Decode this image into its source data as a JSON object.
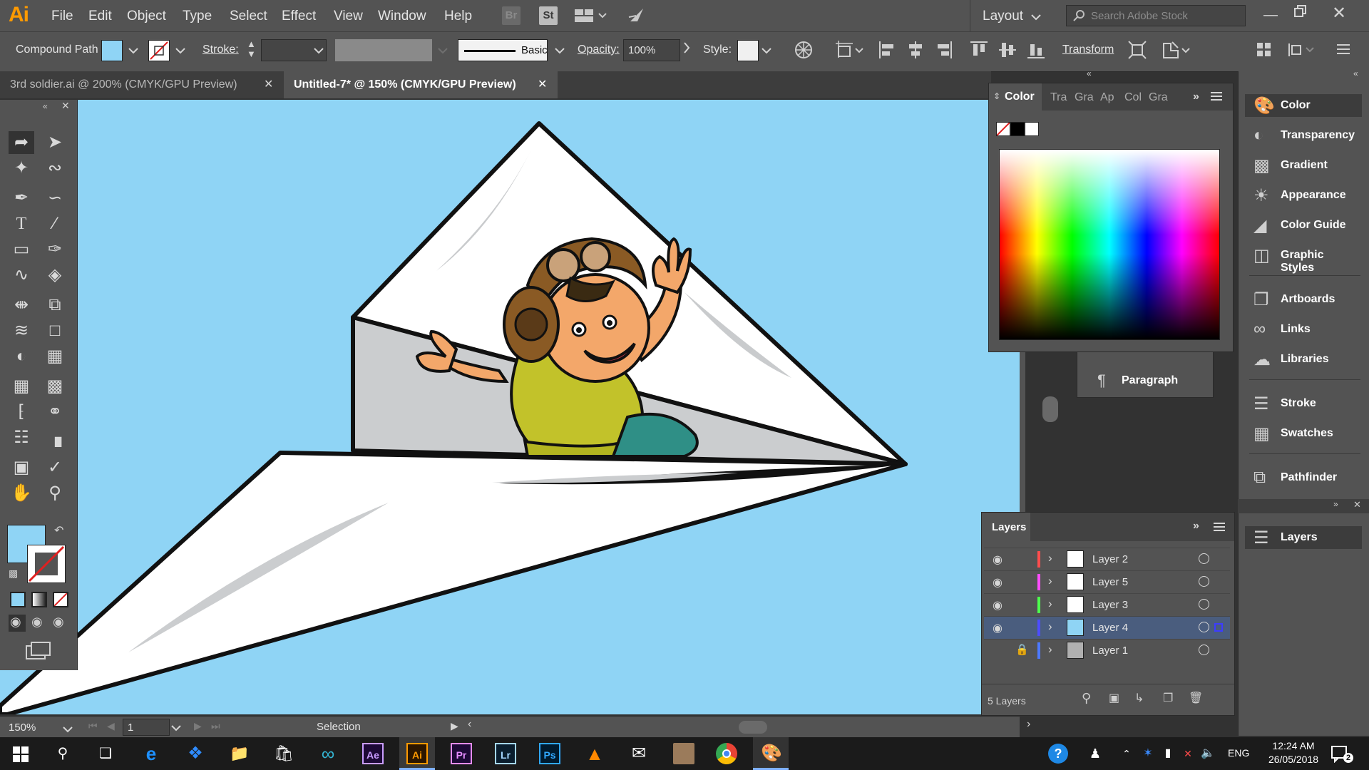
{
  "app": {
    "logo": "Ai",
    "accent": "#ff9a00"
  },
  "menu": [
    "File",
    "Edit",
    "Object",
    "Type",
    "Select",
    "Effect",
    "View",
    "Window",
    "Help"
  ],
  "menu_icons": {
    "bridge": "Br",
    "stock": "St"
  },
  "workspace": {
    "label": "Layout"
  },
  "search": {
    "placeholder": "Search Adobe Stock"
  },
  "control": {
    "selection_type": "Compound Path",
    "stroke_label": "Stroke:",
    "brush_label": "Basic",
    "opacity_label": "Opacity:",
    "opacity_value": "100%",
    "style_label": "Style:",
    "transform_label": "Transform"
  },
  "tabs": [
    {
      "label": "3rd soldier.ai @ 200% (CMYK/GPU Preview)",
      "active": false
    },
    {
      "label": "Untitled-7* @ 150% (CMYK/GPU Preview)",
      "active": true
    }
  ],
  "colors": {
    "fill": "#8fd4f5",
    "canvas": "#8fd4f5",
    "highlight": "#4a5d7e"
  },
  "color_panel": {
    "tabs": [
      "Color",
      "Tra",
      "Gra",
      "Ap",
      "Col",
      "Gra"
    ]
  },
  "partial_panel": {
    "paragraph": "Paragraph"
  },
  "dock": [
    {
      "label": "Color",
      "icon": "palette-icon"
    },
    {
      "label": "Transparency",
      "icon": "transparency-icon"
    },
    {
      "label": "Gradient",
      "icon": "gradient-icon"
    },
    {
      "label": "Appearance",
      "icon": "appearance-icon"
    },
    {
      "label": "Color Guide",
      "icon": "color-guide-icon"
    },
    {
      "label": "Graphic Styles",
      "icon": "graphic-styles-icon"
    },
    {
      "label": "Artboards",
      "icon": "artboards-icon"
    },
    {
      "label": "Links",
      "icon": "links-icon"
    },
    {
      "label": "Libraries",
      "icon": "libraries-icon"
    },
    {
      "label": "Stroke",
      "icon": "stroke-icon"
    },
    {
      "label": "Swatches",
      "icon": "swatches-icon"
    },
    {
      "label": "Pathfinder",
      "icon": "pathfinder-icon"
    }
  ],
  "dock_layers": {
    "label": "Layers"
  },
  "layers_panel": {
    "title": "Layers",
    "count": "5 Layers",
    "rows": [
      {
        "name": "Layer 2",
        "color": "#ff4d4d",
        "visible": true,
        "locked": false,
        "selected": false
      },
      {
        "name": "Layer 5",
        "color": "#ff4dff",
        "visible": true,
        "locked": false,
        "selected": false
      },
      {
        "name": "Layer 3",
        "color": "#4dff4d",
        "visible": true,
        "locked": false,
        "selected": false
      },
      {
        "name": "Layer 4",
        "color": "#4d4dff",
        "visible": true,
        "locked": false,
        "selected": true
      },
      {
        "name": "Layer 1",
        "color": "#4d79ff",
        "visible": false,
        "locked": true,
        "selected": false
      }
    ]
  },
  "status": {
    "zoom": "150%",
    "artboard": "1",
    "tool": "Selection"
  },
  "taskbar": {
    "time": "12:24 AM",
    "date": "26/05/2018",
    "lang": "ENG",
    "notifications": "2"
  },
  "taskbar_apps": [
    "Ae",
    "Ai",
    "Pr",
    "Lr",
    "Ps"
  ]
}
